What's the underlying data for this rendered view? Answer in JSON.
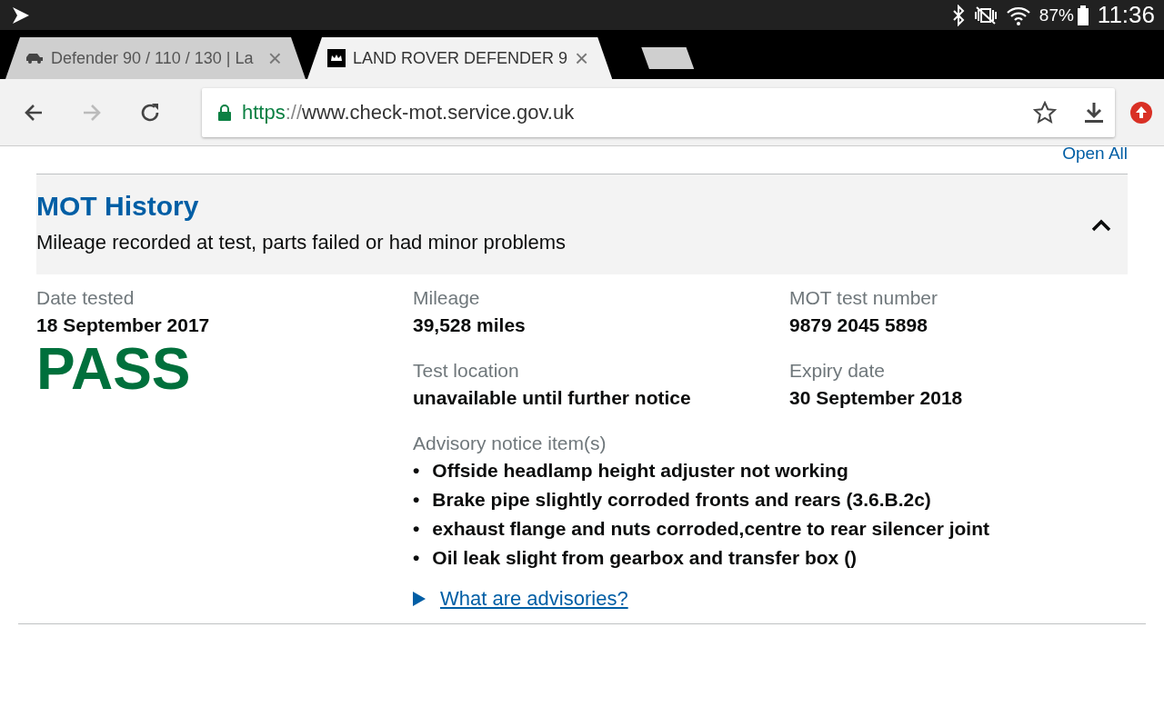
{
  "status_bar": {
    "battery": "87%",
    "time": "11:36"
  },
  "tabs": [
    {
      "title": "Defender 90 / 110 / 130 | La",
      "close": "×",
      "selected": false,
      "kind": "car"
    },
    {
      "title": "LAND ROVER DEFENDER 9",
      "close": "×",
      "selected": true,
      "kind": "crest"
    }
  ],
  "toolbar": {
    "url_scheme": "https",
    "url_separator": "://",
    "url_host": "www.check-mot.service.gov.uk",
    "forward_disabled": true
  },
  "page": {
    "open_all": "Open All",
    "section": {
      "title": "MOT History",
      "subtitle": "Mileage recorded at test, parts failed or had minor problems",
      "expanded": true
    },
    "fields": [
      {
        "label": "Date tested",
        "value": "18 September 2017"
      },
      {
        "label": "Mileage",
        "value": "39,528 miles"
      },
      {
        "label": "MOT test number",
        "value": "9879 2045 5898"
      },
      {
        "label": "Test location",
        "value": "unavailable until further notice"
      },
      {
        "label": "Expiry date",
        "value": "30 September 2018"
      }
    ],
    "result": "PASS",
    "advisory": {
      "label": "Advisory notice item(s)",
      "bullet": "•",
      "items": [
        "Offside headlamp height adjuster not working",
        "Brake pipe slightly corroded fronts and rears (3.6.B.2c)",
        "exhaust flange and nuts corroded,centre to rear silencer joint",
        "Oil leak slight from gearbox and transfer box ()"
      ]
    },
    "details_link": {
      "text": "What are advisories?",
      "expanded": false
    }
  }
}
